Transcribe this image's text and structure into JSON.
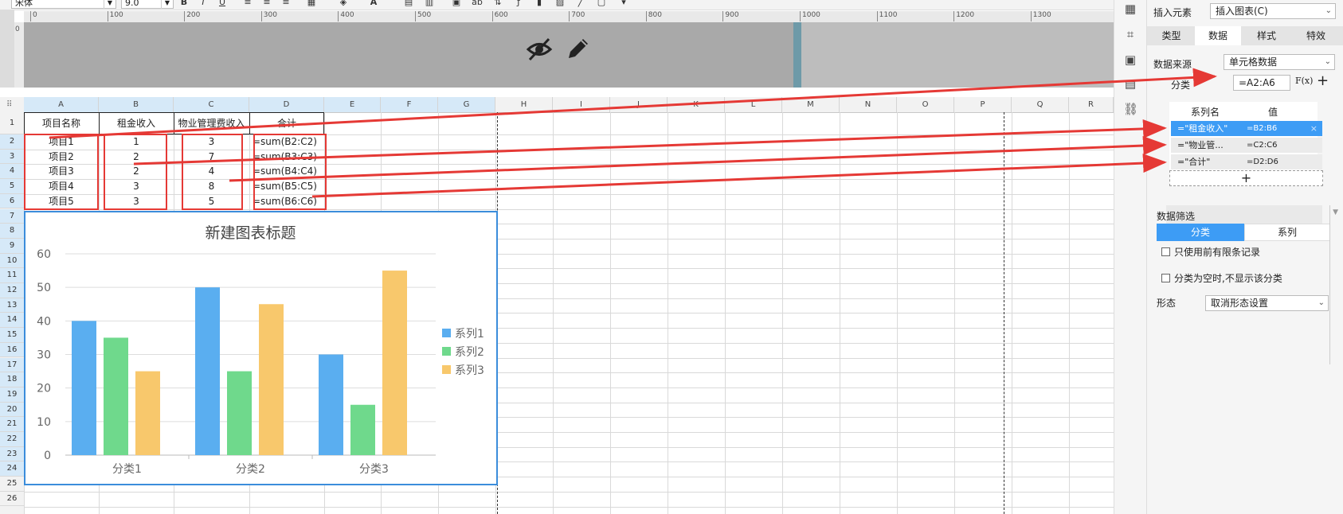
{
  "toolbar": {
    "font_name": "宋体",
    "font_size": "9.0"
  },
  "ruler": {
    "ticks": [
      "0",
      "100",
      "200",
      "300",
      "400",
      "500",
      "600",
      "700",
      "800",
      "900",
      "1000",
      "1100",
      "1200",
      "1300"
    ],
    "vtick": "0"
  },
  "sheet": {
    "columns": [
      "A",
      "B",
      "C",
      "D",
      "E",
      "F",
      "G",
      "H",
      "I",
      "J",
      "K",
      "L",
      "M",
      "N",
      "O",
      "P",
      "Q",
      "R"
    ],
    "rows": [
      "1",
      "2",
      "3",
      "4",
      "5",
      "6",
      "7",
      "8",
      "9",
      "10",
      "11",
      "12",
      "13",
      "14",
      "15",
      "16",
      "17",
      "18",
      "19",
      "20",
      "21",
      "22",
      "23",
      "24",
      "25",
      "26"
    ],
    "table": {
      "headers": [
        "项目名称",
        "租金收入",
        "物业管理费收入",
        "合计"
      ],
      "rows": [
        [
          "项目1",
          "1",
          "3",
          "=sum(B2:C2)"
        ],
        [
          "项目2",
          "2",
          "7",
          "=sum(B3:C3)"
        ],
        [
          "项目3",
          "2",
          "4",
          "=sum(B4:C4)"
        ],
        [
          "项目4",
          "3",
          "8",
          "=sum(B5:C5)"
        ],
        [
          "项目5",
          "3",
          "5",
          "=sum(B6:C6)"
        ]
      ]
    }
  },
  "chart_data": {
    "type": "bar",
    "title": "新建图表标题",
    "categories": [
      "分类1",
      "分类2",
      "分类3"
    ],
    "series": [
      {
        "name": "系列1",
        "values": [
          40,
          50,
          30
        ],
        "color": "#5aaef0"
      },
      {
        "name": "系列2",
        "values": [
          35,
          25,
          15
        ],
        "color": "#6fd98c"
      },
      {
        "name": "系列3",
        "values": [
          25,
          45,
          55
        ],
        "color": "#f8c86c"
      }
    ],
    "yticks": [
      "0",
      "10",
      "20",
      "30",
      "40",
      "50",
      "60"
    ],
    "ylim": [
      0,
      60
    ],
    "grid": true,
    "legend": "right"
  },
  "panel": {
    "insert_label": "插入元素",
    "insert_value": "插入图表(C)",
    "tabs": [
      "类型",
      "数据",
      "样式",
      "特效"
    ],
    "active_tab": "数据",
    "source_label": "数据来源",
    "source_value": "单元格数据",
    "category_label": "分类",
    "category_value": "=A2:A6",
    "fx_label": "F(x)",
    "plus": "+",
    "series_name_header": "系列名",
    "series_value_header": "值",
    "series_rows": [
      {
        "name": "=\"租金收入\"",
        "value": "=B2:B6"
      },
      {
        "name": "=\"物业管...",
        "value": "=C2:C6"
      },
      {
        "name": "=\"合计\"",
        "value": "=D2:D6"
      }
    ],
    "add_series": "+",
    "close_x": "×",
    "filter_label": "数据筛选",
    "filter_tabs": [
      "分类",
      "系列"
    ],
    "opt1": "只使用前有限条记录",
    "opt2": "分类为空时,不显示该分类",
    "shape_label": "形态",
    "shape_value": "取消形态设置"
  },
  "colors": {
    "accent": "#3b8ddb",
    "annotation": "#e53935",
    "selected_header": "#d6e9f8"
  }
}
